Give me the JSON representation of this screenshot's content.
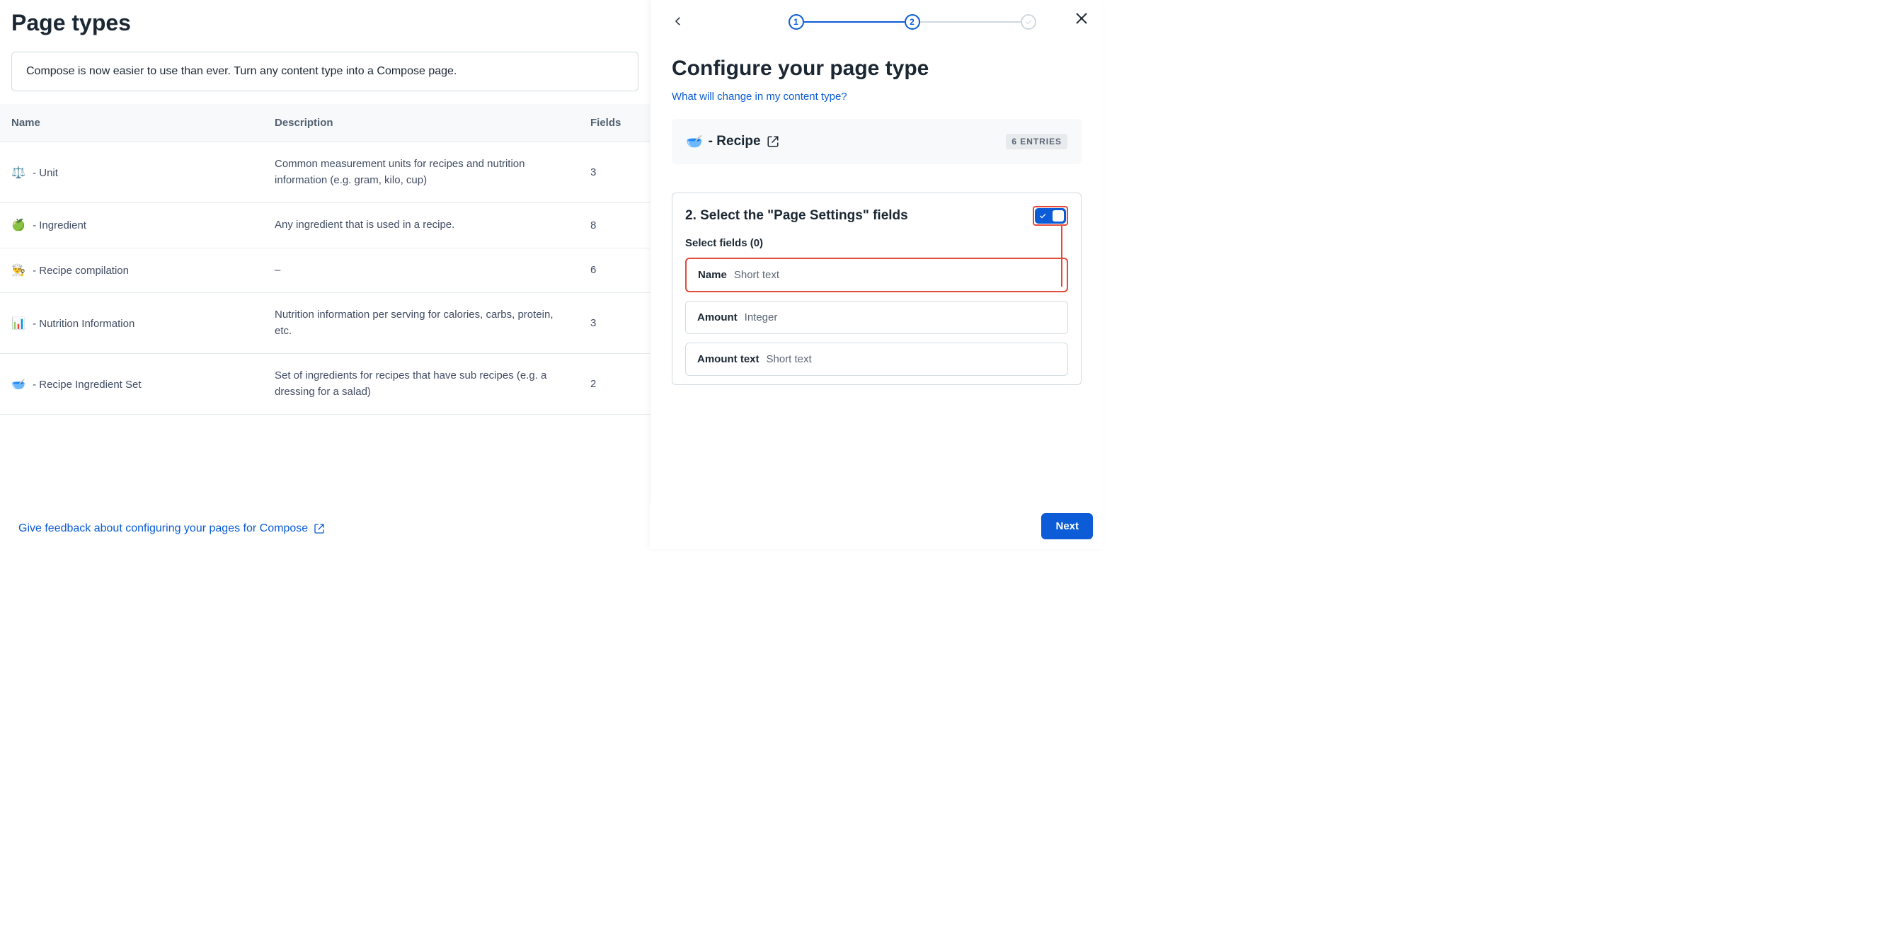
{
  "main": {
    "title": "Page types",
    "banner": "Compose is now easier to use than ever. Turn any content type into a Compose page.",
    "columns": {
      "name": "Name",
      "description": "Description",
      "fields": "Fields"
    },
    "rows": [
      {
        "emoji": "⚖️",
        "name": " - Unit",
        "description": "Common measurement units for recipes and nutrition information (e.g. gram, kilo, cup)",
        "fields": "3"
      },
      {
        "emoji": "🍏",
        "name": " - Ingredient",
        "description": "Any ingredient that is used in a recipe.",
        "fields": "8"
      },
      {
        "emoji": "👨‍🍳",
        "name": " - Recipe compilation",
        "description": "–",
        "fields": "6"
      },
      {
        "emoji": "📊",
        "name": " - Nutrition Information",
        "description": "Nutrition information per serving for calories, carbs, protein, etc.",
        "fields": "3"
      },
      {
        "emoji": "🥣",
        "name": " - Recipe Ingredient Set",
        "description": "Set of ingredients for recipes that have sub recipes (e.g. a dressing for a salad)",
        "fields": "2"
      }
    ],
    "feedback_link": "Give feedback about configuring your pages for Compose"
  },
  "drawer": {
    "steps": {
      "s1": "1",
      "s2": "2"
    },
    "heading": "Configure your page type",
    "help_link": "What will change in my content type?",
    "recipe": {
      "emoji": "🥣",
      "label": " - Recipe",
      "entries_badge": "6 ENTRIES"
    },
    "config": {
      "title": "2. Select the \"Page Settings\" fields",
      "select_label": "Select fields (0)",
      "fields": [
        {
          "name": "Name",
          "type": "Short text"
        },
        {
          "name": "Amount",
          "type": "Integer"
        },
        {
          "name": "Amount text",
          "type": "Short text"
        }
      ]
    },
    "next_label": "Next"
  }
}
